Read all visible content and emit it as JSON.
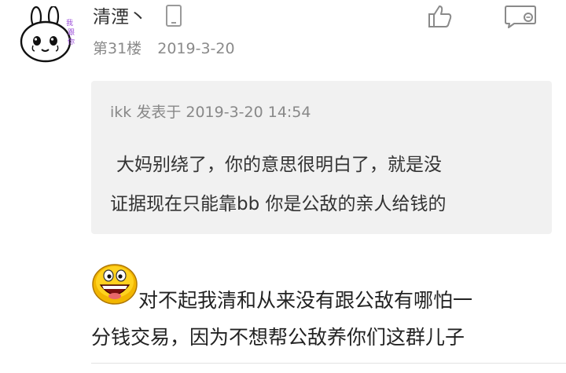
{
  "post": {
    "author": {
      "name": "清湮丶",
      "avatar_icon": "bunny-avatar",
      "device_icon": "phone-icon",
      "avatar_text": "我跟你"
    },
    "floor": "第31楼",
    "date": "2019-3-20",
    "actions": {
      "like_icon": "thumbs-up-icon",
      "reply_icon": "reply-comment-icon"
    },
    "quote": {
      "header": "ikk 发表于 2019-3-20 14:54",
      "lines": [
        "大妈别绕了，你的意思很明白了，就是没",
        "证据现在只能靠bb 你是公敌的亲人给钱的"
      ]
    },
    "content": {
      "emoji_icon": "grinning-face-icon",
      "lines": [
        "对不起我清和从来没有跟公敌有哪怕一",
        "分钱交易，因为不想帮公敌养你们这群儿子"
      ]
    }
  }
}
